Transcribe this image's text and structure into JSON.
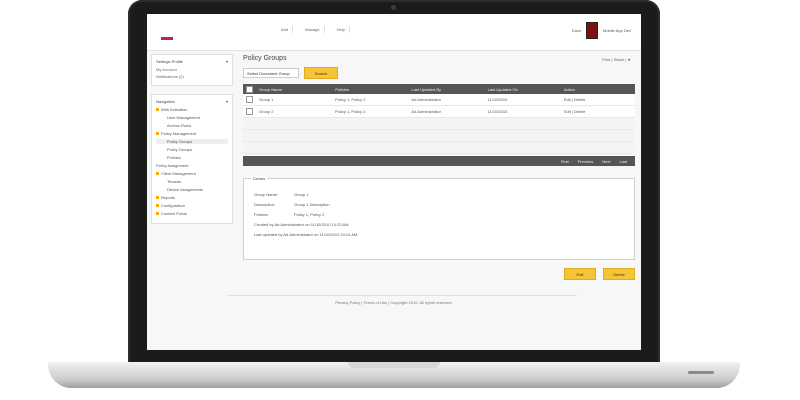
{
  "header": {
    "nav": [
      "Add",
      "Manage",
      "Help"
    ],
    "user_menu": "Docs",
    "user_name": "Mobile App Dev"
  },
  "sidebar": {
    "profile_box": {
      "title": "Settings Profile",
      "lines": [
        "My Account",
        "Notifications (2)"
      ]
    },
    "navigation": {
      "title": "Navigation",
      "items": [
        {
          "label": "Web Activation",
          "level": 1,
          "icon": "dot"
        },
        {
          "label": "User Management",
          "level": 2
        },
        {
          "label": "Access Rules",
          "level": 2
        },
        {
          "label": "Policy Management",
          "level": 1,
          "icon": "dot"
        },
        {
          "label": "Policy Groups",
          "level": 2,
          "selected": true
        },
        {
          "label": "Policy Groups",
          "level": 2
        },
        {
          "label": "Policies",
          "level": 2
        },
        {
          "label": "Policy Assignment",
          "level": 1
        },
        {
          "label": "Client Management",
          "level": 1,
          "icon": "dot"
        },
        {
          "label": "Tenants",
          "level": 2
        },
        {
          "label": "Device Assignments",
          "level": 2
        },
        {
          "label": "Reports",
          "level": 1,
          "icon": "dot"
        },
        {
          "label": "Configuration",
          "level": 1,
          "icon": "dot"
        },
        {
          "label": "Content Portal",
          "level": 1,
          "icon": "dot"
        }
      ]
    }
  },
  "main": {
    "title": "Policy Groups",
    "right_tools": "Print | Share | ★",
    "select_value": "Select Document Group",
    "search_label": "Search",
    "table": {
      "headers": [
        "Group Name",
        "Policies",
        "Last Updated By",
        "Last Updated On",
        "Action"
      ],
      "rows": [
        [
          "Group 1",
          "Policy 1, Policy 2",
          "Ad.Administrator",
          "11/10/2010",
          "Edit | Delete"
        ],
        [
          "Group 2",
          "Policy 1, Policy 2",
          "Ad.Administrator",
          "11/10/2010",
          "Edit | Delete"
        ]
      ],
      "pagination": [
        "First",
        "Previous",
        "Next",
        "Last"
      ]
    },
    "details": {
      "title": "Details",
      "rows": [
        {
          "label": "Group Name:",
          "value": "Group 1"
        },
        {
          "label": "Description:",
          "value": "Group 1 Description"
        },
        {
          "label": "Policies:",
          "value": "Policy 1, Policy 2"
        }
      ],
      "extra": [
        "Created by Ad.Administrator on 11/10/2010 10:22 AM",
        "Last updated by Ad.Administrator on 11/10/2010 10:24 AM"
      ]
    },
    "actions": {
      "edit": "Edit",
      "delete": "Delete"
    }
  },
  "footer": {
    "text": "Privacy Policy | Terms of Use | Copyright 2010. All rights reserved."
  }
}
